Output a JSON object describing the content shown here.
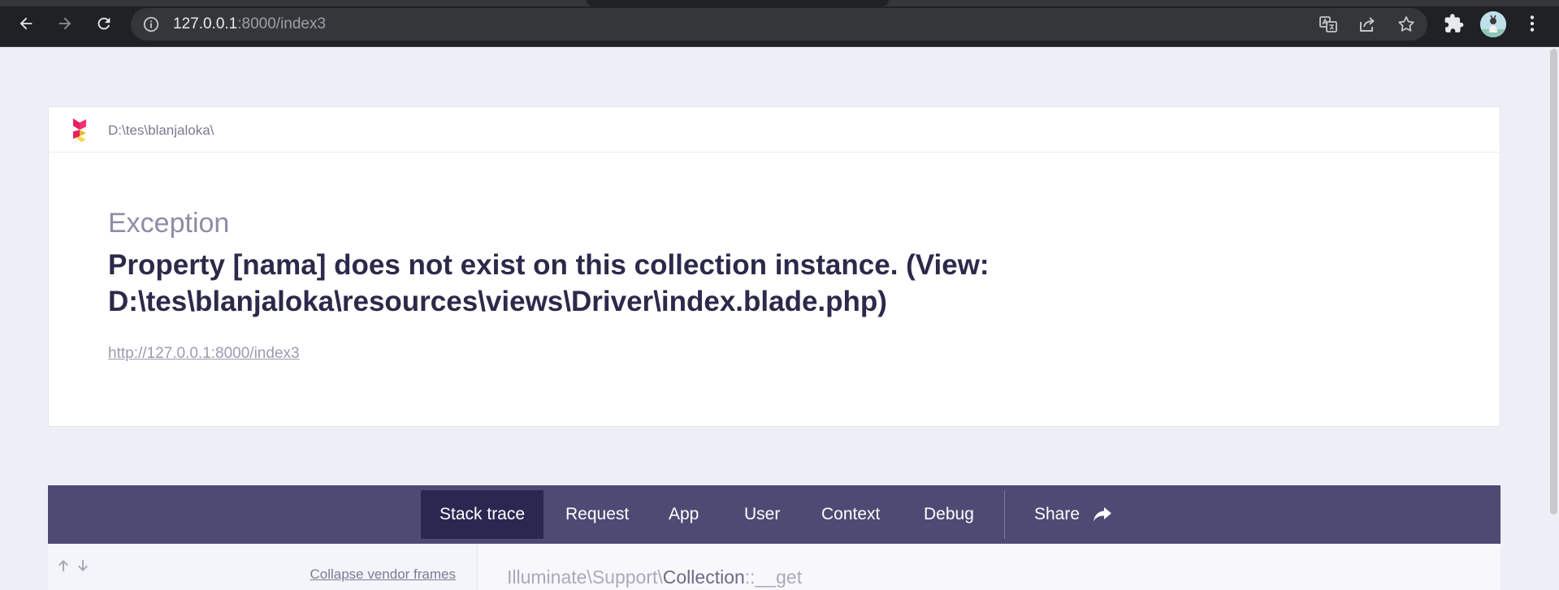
{
  "browser": {
    "url_host": "127.0.0.1",
    "url_rest": ":8000/index3"
  },
  "page": {
    "project_path": "D:\\tes\\blanjaloka\\",
    "exception_class": "Exception",
    "exception_message": "Property [nama] does not exist on this collection instance. (View: D:\\tes\\blanjaloka\\resources\\views\\Driver\\index.blade.php)",
    "request_url": "http://127.0.0.1:8000/index3"
  },
  "tabs": [
    {
      "label": "Stack trace",
      "active": true
    },
    {
      "label": "Request",
      "active": false
    },
    {
      "label": "App",
      "active": false
    },
    {
      "label": "User",
      "active": false
    },
    {
      "label": "Context",
      "active": false
    },
    {
      "label": "Debug",
      "active": false
    }
  ],
  "share_label": "Share",
  "trace": {
    "collapse_label": "Collapse vendor frames",
    "frame_namespace": "Illuminate\\Support\\",
    "frame_class": "Collection",
    "frame_method": "::__get"
  },
  "colors": {
    "tabbar": "#4d4a73",
    "tab_active": "#2b2751",
    "message": "#2b2a4a"
  }
}
